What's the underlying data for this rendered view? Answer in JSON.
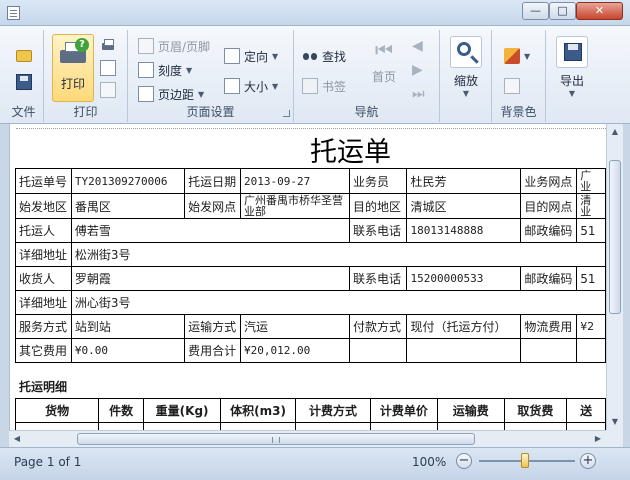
{
  "window": {
    "minimize": "—",
    "maximize": "□",
    "close": "✕"
  },
  "ribbon": {
    "file_group": {
      "label": "文件"
    },
    "print_group": {
      "label": "打印",
      "print_button": "打印"
    },
    "page_setup_group": {
      "label": "页面设置",
      "header_footer": "页眉/页脚",
      "scale": "刻度",
      "margins": "页边距",
      "orientation": "定向",
      "size": "大小"
    },
    "navigation_group": {
      "label": "导航",
      "find": "查找",
      "bookmarks": "书签",
      "first_page": "首页"
    },
    "zoom_group": {
      "zoom": "缩放"
    },
    "background_group": {
      "label": "背景色"
    },
    "export_group": {
      "export": "导出"
    }
  },
  "document": {
    "title": "托运单",
    "rows": [
      [
        "托运单号",
        "TY201309270006",
        "托运日期",
        "2013-09-27",
        "业务员",
        "杜民芳",
        "业务网点",
        "广业"
      ],
      [
        "始发地区",
        "番禺区",
        "始发网点",
        "广州番禺市桥华圣营业部",
        "目的地区",
        "清城区",
        "目的网点",
        "清业"
      ],
      [
        "托运人",
        "傅若雪",
        "联系电话",
        "18013148888",
        "邮政编码",
        "51"
      ],
      [
        "详细地址",
        "松洲街3号"
      ],
      [
        "收货人",
        "罗朝霞",
        "联系电话",
        "15200000533",
        "邮政编码",
        "51"
      ],
      [
        "详细地址",
        "洲心街3号"
      ],
      [
        "服务方式",
        "站到站",
        "运输方式",
        "汽运",
        "付款方式",
        "现付（托运方付）",
        "物流费用",
        "¥2"
      ],
      [
        "其它费用",
        "¥0.00",
        "费用合计",
        "¥20,012.00",
        "",
        "",
        "",
        ""
      ]
    ],
    "detail_title": "托运明细",
    "detail_headers": [
      "货物",
      "件数",
      "重量(Kg)",
      "体积(m3)",
      "计费方式",
      "计费单价",
      "运输费",
      "取货费",
      "送"
    ]
  },
  "status": {
    "page_info": "Page 1 of 1",
    "zoom_percent": "100%",
    "zoom_out": "−",
    "zoom_in": "+",
    "zoom_level": 1.0
  },
  "scroll": {
    "up": "▲",
    "down": "▼",
    "left": "◀",
    "right": "▶"
  }
}
